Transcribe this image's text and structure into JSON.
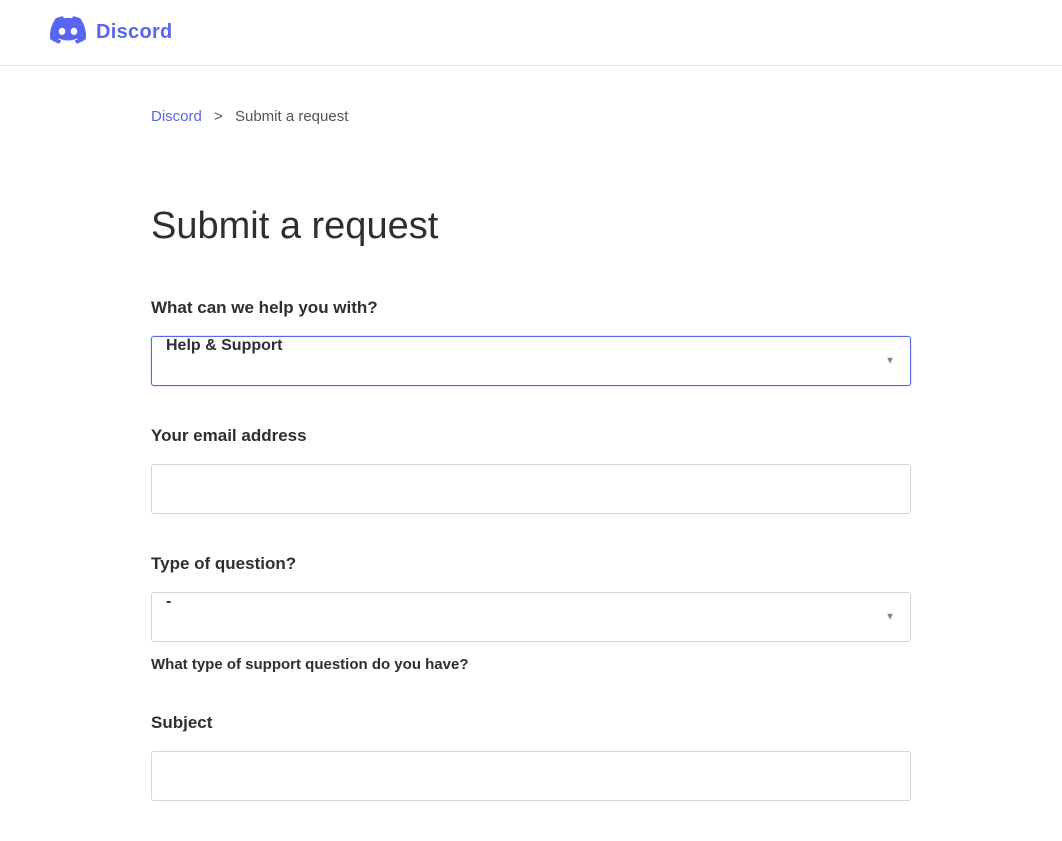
{
  "header": {
    "logo_text": "Discord"
  },
  "breadcrumb": {
    "home": "Discord",
    "separator": ">",
    "current": "Submit a request"
  },
  "page_title": "Submit a request",
  "form": {
    "help_with": {
      "label": "What can we help you with?",
      "selected": "Help & Support"
    },
    "email": {
      "label": "Your email address",
      "value": ""
    },
    "question_type": {
      "label": "Type of question?",
      "selected": "-",
      "help_text": "What type of support question do you have?"
    },
    "subject": {
      "label": "Subject",
      "value": ""
    }
  }
}
